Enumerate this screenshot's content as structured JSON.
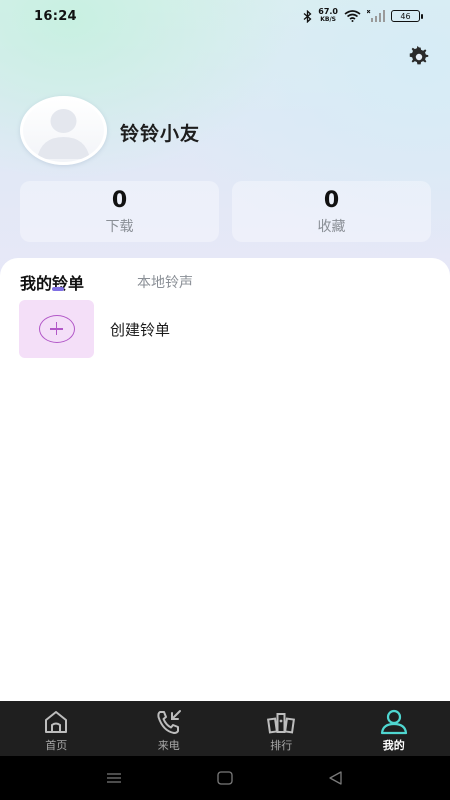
{
  "status_bar": {
    "time": "16:24",
    "net_speed_value": "67.0",
    "net_speed_unit": "KB/S",
    "battery": "46",
    "icons": [
      "bluetooth-icon",
      "wifi-icon",
      "no-signal-icon",
      "battery-icon"
    ]
  },
  "profile": {
    "nickname": "铃铃小友",
    "settings_icon": "gear-icon"
  },
  "stats": [
    {
      "value": "0",
      "label": "下载"
    },
    {
      "value": "0",
      "label": "收藏"
    }
  ],
  "list_tabs": {
    "active": "我的铃单",
    "inactive": "本地铃声"
  },
  "create_item": {
    "label": "创建铃单",
    "icon": "plus-circle-icon"
  },
  "bottom_tabs": [
    {
      "label": "首页",
      "icon": "home-icon",
      "active": false
    },
    {
      "label": "来电",
      "icon": "incoming-call-icon",
      "active": false
    },
    {
      "label": "排行",
      "icon": "ranking-icon",
      "active": false
    },
    {
      "label": "我的",
      "icon": "user-icon",
      "active": true
    }
  ],
  "colors": {
    "accent_active_icon": "#4fd6d0",
    "tab_indicator": "#7f6fe3",
    "create_thumb_bg": "#f4dff8",
    "plus_color": "#b258c8",
    "tabbar_bg": "#1f1f1f"
  }
}
